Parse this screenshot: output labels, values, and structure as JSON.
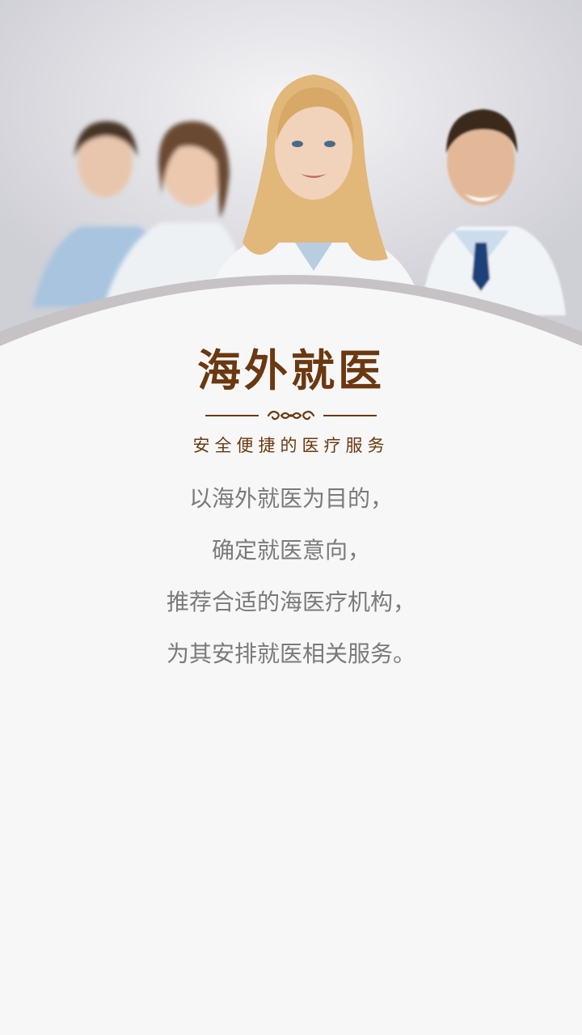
{
  "hero": {
    "image": "medical-team-photo",
    "colors": {
      "coat": "#f4f6f8",
      "scrub": "#a9c4df",
      "hair_blonde": "#e2b77a",
      "hair_dark": "#4a3528",
      "tie": "#1f3f7a"
    }
  },
  "header": {
    "title": "海外就医",
    "subtitle": "安全便捷的医疗服务"
  },
  "description": {
    "lines": [
      "以海外就医为目的，",
      "确定就医意向，",
      "推荐合适的海医疗机构，",
      "为其安排就医相关服务。"
    ]
  },
  "colors": {
    "brand_brown": "#6b3810",
    "body_text": "#7a7a7a",
    "background": "#f7f7f7",
    "arc_shadow": "#c7c2c6"
  }
}
